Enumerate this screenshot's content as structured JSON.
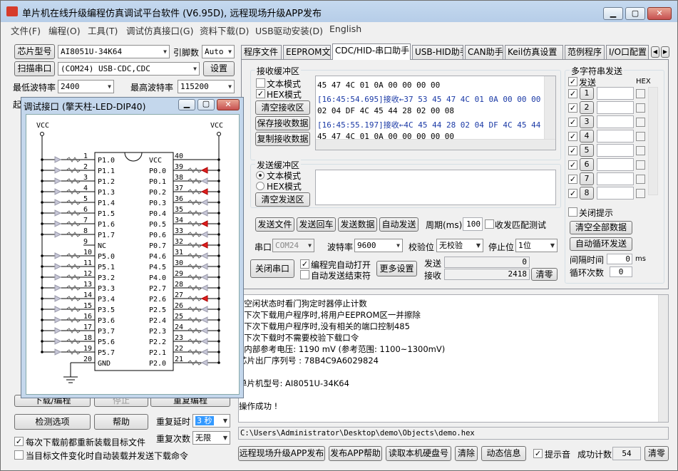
{
  "window": {
    "title": "单片机在线升级编程仿真调试平台软件 (V6.95D), 远程现场升级APP发布"
  },
  "menu": [
    "文件(F)",
    "编程(O)",
    "工具(T)",
    "调试仿真接口(G)",
    "资料下载(D)",
    "USB驱动安装(D)",
    "English"
  ],
  "left": {
    "chip_btn": "芯片型号",
    "chip_value": "AI8051U-34K64",
    "pin_label": "引脚数",
    "pin_value": "Auto",
    "scan_btn": "扫描串口",
    "port_value": "(COM24) USB-CDC,CDC",
    "settings_btn": "设置",
    "min_baud_label": "最低波特率",
    "min_baud": "2400",
    "max_baud_label": "最高波特率",
    "max_baud": "115200",
    "start_label": "起",
    "download_btn": "下载/编程",
    "stop_btn": "停止",
    "redownload_btn": "重复编程",
    "check_btn": "检测选项",
    "help_btn": "帮助",
    "repeat_delay_label": "重复延时",
    "repeat_delay": "3 秒",
    "repeat_count_label": "重复次数",
    "repeat_count": "无限",
    "reload_label": "每次下载前都重新装载目标文件",
    "autoload_label": "当目标文件变化时自动装载并发送下载命令"
  },
  "tabs": [
    "程序文件",
    "EEPROM文件",
    "CDC/HID-串口助手",
    "USB-HID助手",
    "CAN助手",
    "Keil仿真设置",
    "范例程序",
    "I/O口配置"
  ],
  "recv": {
    "title": "接收缓冲区",
    "text_mode": "文本模式",
    "hex_mode": "HEX模式",
    "clear_btn": "清空接收区",
    "save_btn": "保存接收数据",
    "copy_btn": "复制接收数据",
    "lines": [
      "            45 47 4C 01 0A 00 00 00 00",
      "[16:45:54.695]接收←37 53 45 47 4C 01 0A 00 00 00 00",
      "            02 04 DF 4C 45 44 28 02 00 08",
      "[16:45:55.197]接收←4C 45 44 28 02 04 DF 4C 45 44 28",
      "            45 47 4C 01 0A 00 00 00 00 00"
    ]
  },
  "send": {
    "title": "发送缓冲区",
    "text_mode": "文本模式",
    "hex_mode": "HEX模式",
    "clear_btn": "清空发送区",
    "send_file": "发送文件",
    "send_back": "发送回车",
    "send_data": "发送数据",
    "auto_send": "自动发送",
    "period_label": "周期(ms)",
    "period": "100",
    "match_label": "收发匹配测试"
  },
  "serial": {
    "port_label": "串口",
    "port": "COM24",
    "baud_label": "波特率",
    "baud": "9600",
    "parity_label": "校验位",
    "parity": "无校验",
    "stop_label": "停止位",
    "stop": "1位",
    "close_btn": "关闭串口",
    "auto_open": "编程完自动打开",
    "auto_end": "自动发送结束符",
    "more_btn": "更多设置",
    "send_label": "发送",
    "send_count": "0",
    "recv_label": "接收",
    "recv_count": "2418",
    "clear_btn": "清零"
  },
  "multi": {
    "title": "多字符串发送",
    "send_col": "发送",
    "hex_col": "HEX",
    "rows": [
      "1",
      "2",
      "3",
      "4",
      "5",
      "6",
      "7",
      "8"
    ],
    "close_tip": "关闭提示",
    "clear_all": "清空全部数据",
    "auto_loop": "自动循环发送",
    "interval_label": "间隔时间",
    "interval": "0",
    "interval_unit": "ms",
    "loop_label": "循环次数",
    "loop": "0"
  },
  "log": [
    ". 空闲状态时看门狗定时器停止计数",
    ". 下次下载用户程序时,将用户EEPROM区一并擦除",
    ". 下次下载用户程序时,没有相关的端口控制485",
    ". 下次下载时不需要校验下载口令",
    ". 内部参考电压: 1190 mV (参考范围: 1100~1300mV)",
    "芯片出厂序列号 : 78B4C9A6029824",
    "",
    "单片机型号: AI8051U-34K64",
    "",
    "操作成功 !"
  ],
  "path": "C:\\Users\\Administrator\\Desktop\\demo\\Objects\\demo.hex",
  "bottom": {
    "remote_btn": "远程现场升级APP发布",
    "app_help": "发布APP帮助",
    "read_disk": "读取本机硬盘号",
    "clear_btn": "清除",
    "dynamic_btn": "动态信息",
    "beep_label": "提示音",
    "success_label": "成功计数",
    "success_count": "54",
    "zero_btn": "清零"
  },
  "dialog": {
    "title": "调试接口 (擎天柱-LED-DIP40)",
    "vcc": "VCC",
    "left_pins": [
      {
        "n": "1",
        "name": "P1.0"
      },
      {
        "n": "2",
        "name": "P1.1"
      },
      {
        "n": "3",
        "name": "P1.2"
      },
      {
        "n": "4",
        "name": "P1.3"
      },
      {
        "n": "5",
        "name": "P1.4"
      },
      {
        "n": "6",
        "name": "P1.5"
      },
      {
        "n": "7",
        "name": "P1.6"
      },
      {
        "n": "8",
        "name": "P1.7"
      },
      {
        "n": "9",
        "name": "NC"
      },
      {
        "n": "10",
        "name": "P5.0"
      },
      {
        "n": "11",
        "name": "P5.1"
      },
      {
        "n": "12",
        "name": "P3.2"
      },
      {
        "n": "13",
        "name": "P3.3"
      },
      {
        "n": "14",
        "name": "P3.4"
      },
      {
        "n": "15",
        "name": "P3.5"
      },
      {
        "n": "16",
        "name": "P3.6"
      },
      {
        "n": "17",
        "name": "P3.7"
      },
      {
        "n": "18",
        "name": "P5.6"
      },
      {
        "n": "19",
        "name": "P5.7"
      },
      {
        "n": "20",
        "name": "GND"
      }
    ],
    "right_pins": [
      {
        "n": "40",
        "name": "VCC"
      },
      {
        "n": "39",
        "name": "P0.0"
      },
      {
        "n": "38",
        "name": "P0.1"
      },
      {
        "n": "37",
        "name": "P0.2"
      },
      {
        "n": "36",
        "name": "P0.3"
      },
      {
        "n": "35",
        "name": "P0.4"
      },
      {
        "n": "34",
        "name": "P0.5"
      },
      {
        "n": "33",
        "name": "P0.6"
      },
      {
        "n": "32",
        "name": "P0.7"
      },
      {
        "n": "31",
        "name": "P4.6"
      },
      {
        "n": "30",
        "name": "P4.5"
      },
      {
        "n": "29",
        "name": "P4.0"
      },
      {
        "n": "28",
        "name": "P2.7"
      },
      {
        "n": "27",
        "name": "P2.6"
      },
      {
        "n": "26",
        "name": "P2.5"
      },
      {
        "n": "25",
        "name": "P2.4"
      },
      {
        "n": "24",
        "name": "P2.3"
      },
      {
        "n": "23",
        "name": "P2.2"
      },
      {
        "n": "22",
        "name": "P2.1"
      },
      {
        "n": "21",
        "name": "P2.0"
      }
    ],
    "lit_right": [
      "39",
      "37",
      "34",
      "32",
      "27"
    ]
  },
  "colors": {
    "led_on": "#e02020",
    "led_off": "#c8c8d8",
    "accent": "#3399ff"
  }
}
